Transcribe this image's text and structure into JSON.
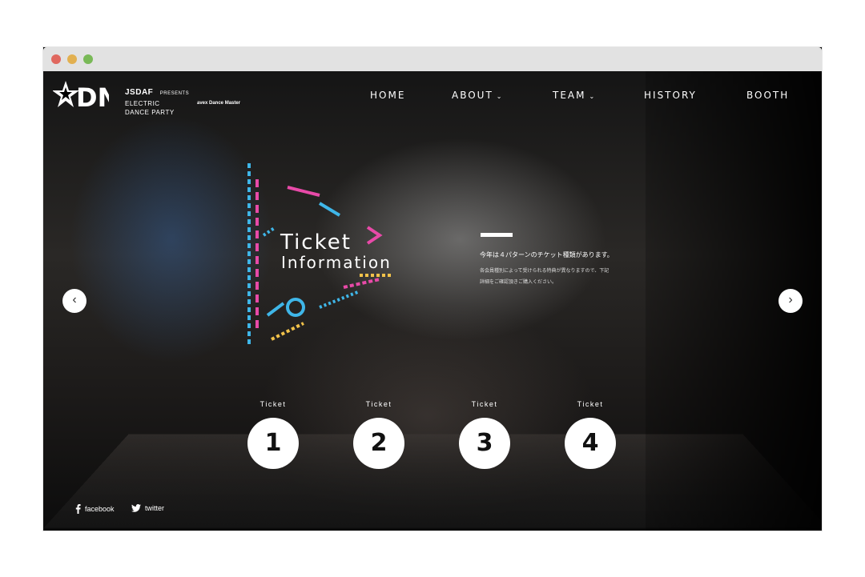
{
  "browser": {
    "dots": [
      "#e0685f",
      "#e2b050",
      "#79b957"
    ]
  },
  "brand": {
    "logo_text": "DN",
    "org": "JSDAF",
    "presents": "PRESENTS",
    "event_line1": "ELECTRIC",
    "event_line2": "DANCE PARTY",
    "sponsor": "avex Dance Master"
  },
  "nav": {
    "home": "HOME",
    "about": "ABOUT",
    "team": "TEAM",
    "history": "HISTORY",
    "booth": "BOOTH"
  },
  "hero": {
    "title_line1": "Ticket",
    "title_line2": "Information",
    "description": "今年は４パターンのチケット種類があります。",
    "note_line1": "各会員種別によって受けられる特典が異なりますので、下記",
    "note_line2": "詳細をご確認頂きご購入ください。"
  },
  "tickets": [
    {
      "label": "Ticket",
      "number": "1"
    },
    {
      "label": "Ticket",
      "number": "2"
    },
    {
      "label": "Ticket",
      "number": "3"
    },
    {
      "label": "Ticket",
      "number": "4"
    }
  ],
  "social": {
    "facebook": "facebook",
    "twitter": "twitter"
  },
  "icons": {
    "prev": "chevron-left-icon",
    "next": "chevron-right-icon",
    "about_dropdown": "chevron-down-icon",
    "team_dropdown": "chevron-down-icon"
  }
}
